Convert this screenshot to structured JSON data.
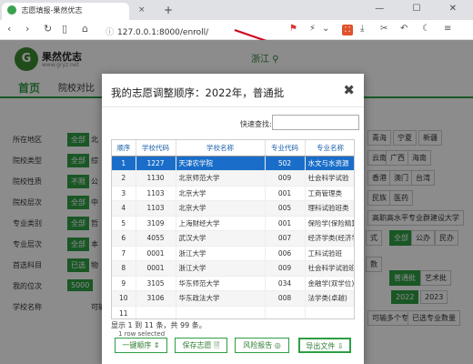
{
  "browser": {
    "tab_title": "志愿填报-果然优志",
    "tab_close": "×",
    "tab_new": "+",
    "url": "127.0.0.1:8000/enroll/",
    "window_controls": "— ☐ ✕"
  },
  "page": {
    "logo_letter": "G",
    "site_name": "果然优志",
    "site_sub": "www.gryz.net",
    "province": "浙江",
    "nav": {
      "home": "首页",
      "compare": "院校对比"
    },
    "filters": [
      {
        "label": "所在地区",
        "all": "全部",
        "opts": [
          "北"
        ]
      },
      {
        "label": "院校类型",
        "all": "全部",
        "opts": [
          "综"
        ]
      },
      {
        "label": "院校性质",
        "all": "不限",
        "opts": [
          "公"
        ]
      },
      {
        "label": "院校层次",
        "all": "全部",
        "opts": [
          "中"
        ]
      },
      {
        "label": "专业类别",
        "all": "全部",
        "opts": [
          "哲"
        ]
      },
      {
        "label": "专业层次",
        "all": "全部",
        "opts": [
          "本"
        ]
      },
      {
        "label": "首选科目",
        "all": "已选",
        "opts": [
          "物"
        ]
      },
      {
        "label": "我的位次",
        "all": "5000",
        "opts": []
      },
      {
        "label": "学校名称",
        "all": "",
        "opts": [
          "可输多个学"
        ]
      }
    ],
    "right_chips": [
      "青海",
      "宁夏",
      "新疆",
      "云南",
      "广西",
      "海南",
      "香港",
      "澳门",
      "台湾",
      "民族",
      "医药",
      "高职高水平专业群建设大学",
      "全部",
      "公办",
      "民办",
      "普通批",
      "艺术批",
      "2022",
      "2023",
      "可输多个专业，使用空格",
      "已选专业数量",
      "数",
      "式"
    ]
  },
  "modal": {
    "title": "我的志愿调整顺序：2022年，普通批",
    "close": "✖",
    "search_label": "快速查找:",
    "search_value": "",
    "columns": [
      "顺序",
      "学校代码",
      "学校名称",
      "专业代码",
      "专业名称"
    ],
    "rows": [
      {
        "order": "1",
        "school_code": "1227",
        "school": "天津农学院",
        "major_code": "502",
        "major": "水文与水资源"
      },
      {
        "order": "2",
        "school_code": "1130",
        "school": "北京师范大学",
        "major_code": "009",
        "major": "社会科学试验"
      },
      {
        "order": "3",
        "school_code": "1103",
        "school": "北京大学",
        "major_code": "001",
        "major": "工商管理类"
      },
      {
        "order": "4",
        "school_code": "1103",
        "school": "北京大学",
        "major_code": "005",
        "major": "理科试验班类"
      },
      {
        "order": "5",
        "school_code": "3109",
        "school": "上海财经大学",
        "major_code": "001",
        "major": "保险学(保险精算)"
      },
      {
        "order": "6",
        "school_code": "4055",
        "school": "武汉大学",
        "major_code": "007",
        "major": "经济学类(经济学)"
      },
      {
        "order": "7",
        "school_code": "0001",
        "school": "浙江大学",
        "major_code": "006",
        "major": "工科试验班"
      },
      {
        "order": "8",
        "school_code": "0001",
        "school": "浙江大学",
        "major_code": "009",
        "major": "社会科学试验班"
      },
      {
        "order": "9",
        "school_code": "3105",
        "school": "华东师范大学",
        "major_code": "034",
        "major": "金融学(双学位)"
      },
      {
        "order": "10",
        "school_code": "3106",
        "school": "华东政法大学",
        "major_code": "008",
        "major": "法学类(卓越)"
      },
      {
        "order": "11",
        "school_code": "",
        "school": "",
        "major_code": "",
        "major": ""
      }
    ],
    "selected_index": 0,
    "footer_info": "显示 1 到 11 条，共 99 条。",
    "row_selected": "1 row selected",
    "buttons": {
      "order": "一键顺序 ⇕",
      "save": "保存志愿 🗎",
      "risk": "风险报告 ◎",
      "export": "导出文件 ⇩"
    }
  }
}
